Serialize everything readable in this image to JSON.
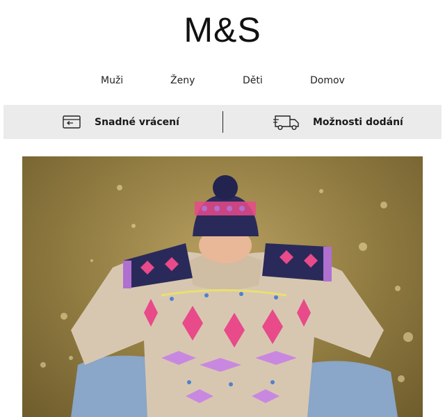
{
  "brand": {
    "logo_text": "M&S"
  },
  "nav": {
    "items": [
      {
        "label": "Muži"
      },
      {
        "label": "Ženy"
      },
      {
        "label": "Děti"
      },
      {
        "label": "Domov"
      }
    ]
  },
  "services": {
    "returns_label": "Snadné vrácení",
    "delivery_label": "Možnosti dodání",
    "returns_icon": "return-card-icon",
    "delivery_icon": "delivery-truck-icon"
  },
  "hero": {
    "image": "model-in-fair-isle-jumper-and-bobble-hat",
    "colors": {
      "background": "#8f7a40",
      "jumper": "#d8c7b0",
      "hat": "#2a2a5a",
      "pattern_pink": "#e84a8a",
      "pattern_purple": "#b070d0"
    }
  }
}
